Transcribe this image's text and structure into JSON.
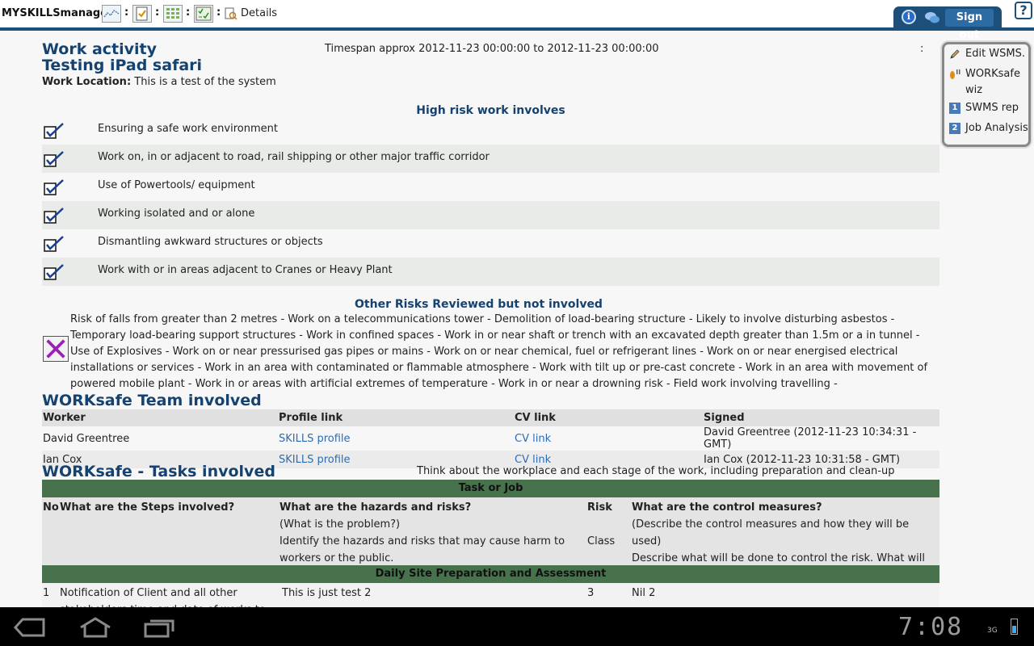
{
  "toolbar": {
    "brand": "MYSKILLSmanager",
    "colon": ":",
    "details_label": "Details",
    "signout_label": "Sign out",
    "help_glyph": "?",
    "info_glyph": "i",
    "icons": [
      "chart-icon",
      "clipboard-check-icon",
      "grid-icon",
      "checklist-icon",
      "details-icon",
      "info-icon",
      "chat-icon",
      "help-icon"
    ]
  },
  "header": {
    "title_line1": "Work activity",
    "title_line2": "Testing iPad safari",
    "location_label": "Work Location:",
    "location_value": " This is a test of the system",
    "timespan": "Timespan approx 2012-11-23 00:00:00 to 2012-11-23 00:00:00",
    "right_colon": ":"
  },
  "high_risk": {
    "heading": "High risk work involves",
    "items": [
      "Ensuring a safe work environment",
      "Work on, in or adjacent to road, rail shipping or other major traffic corridor",
      "Use of Powertools/ equipment",
      "Working isolated and or alone",
      "Dismantling awkward structures or objects",
      "Work with or in areas adjacent to Cranes or Heavy Plant"
    ]
  },
  "other_risks": {
    "heading": "Other Risks Reviewed but not involved",
    "text": "Risk of falls from greater than 2 metres  -  Work on a telecommunications tower  -  Demolition of load-bearing structure  -  Likely to involve disturbing asbestos  -  Temporary load-bearing support structures  -  Work in confined spaces  -  Work in or near shaft or trench with an excavated depth greater than 1.5m or a in tunnel  -  Use of Explosives  -  Work on or near pressurised gas pipes or mains  -  Work on or near chemical, fuel or refrigerant lines  -  Work on or near energised electrical installations or services  -  Work in an area with contaminated or flammable atmosphere  -  Work with tilt up or pre-cast concrete  -  Work in an area with movement of powered mobile plant  -  Work in or areas with artificial extremes of temperature  -  Work in or near a drowning risk  -  Field work involving travelling  -"
  },
  "team": {
    "heading": "WORKsafe Team involved",
    "columns": [
      "Worker",
      "Profile link",
      "CV link",
      "Signed"
    ],
    "rows": [
      {
        "worker": "David Greentree",
        "profile": "SKILLS profile",
        "cv": "CV link",
        "signed": "David Greentree (2012-11-23 10:34:31 - GMT)"
      },
      {
        "worker": "Ian Cox",
        "profile": "SKILLS profile",
        "cv": "CV link",
        "signed": "Ian Cox (2012-11-23 10:31:58 - GMT)"
      }
    ]
  },
  "tasks": {
    "heading": "WORKsafe - Tasks involved",
    "note": "Think about the workplace and each stage of the work, including preparation and clean-up",
    "bar_title": "Task or Job",
    "col_no": "No",
    "col_steps": "What are the Steps involved?",
    "col_hazards": "What are the hazards and risks?",
    "col_hazards_sub1": "(What is the problem?)",
    "col_hazards_sub2": "Identify the hazards and risks that may cause harm to workers or the public.",
    "col_risk": "Risk",
    "col_risk_sub": "Class",
    "col_control": "What are the control measures?",
    "col_control_sub1": "(Describe the control measures and how they will be used)",
    "col_control_sub2": "Describe what will be done to control the risk. What will you do to make the activity as safe as possible?",
    "section_title": "Daily Site Preparation and Assessment",
    "row": {
      "no": "1",
      "step": "Notification of Client and all other stakeholders time and date of works to be",
      "hazard": "This is just test 2",
      "risk": "3",
      "control": "Nil 2"
    }
  },
  "sidepanel": {
    "items": [
      {
        "label": "Edit WSMS."
      },
      {
        "label": "WORKsafe wiz"
      },
      {
        "label": "SWMS rep",
        "badge": "1"
      },
      {
        "label": "Job Analysis",
        "badge": "2"
      }
    ]
  },
  "system": {
    "clock": "7:08",
    "network": "3G"
  },
  "colors": {
    "brand_blue": "#15426f",
    "bar_blue": "#1c4f7a",
    "green_bar": "#47724c",
    "link": "#2d6cb4"
  }
}
